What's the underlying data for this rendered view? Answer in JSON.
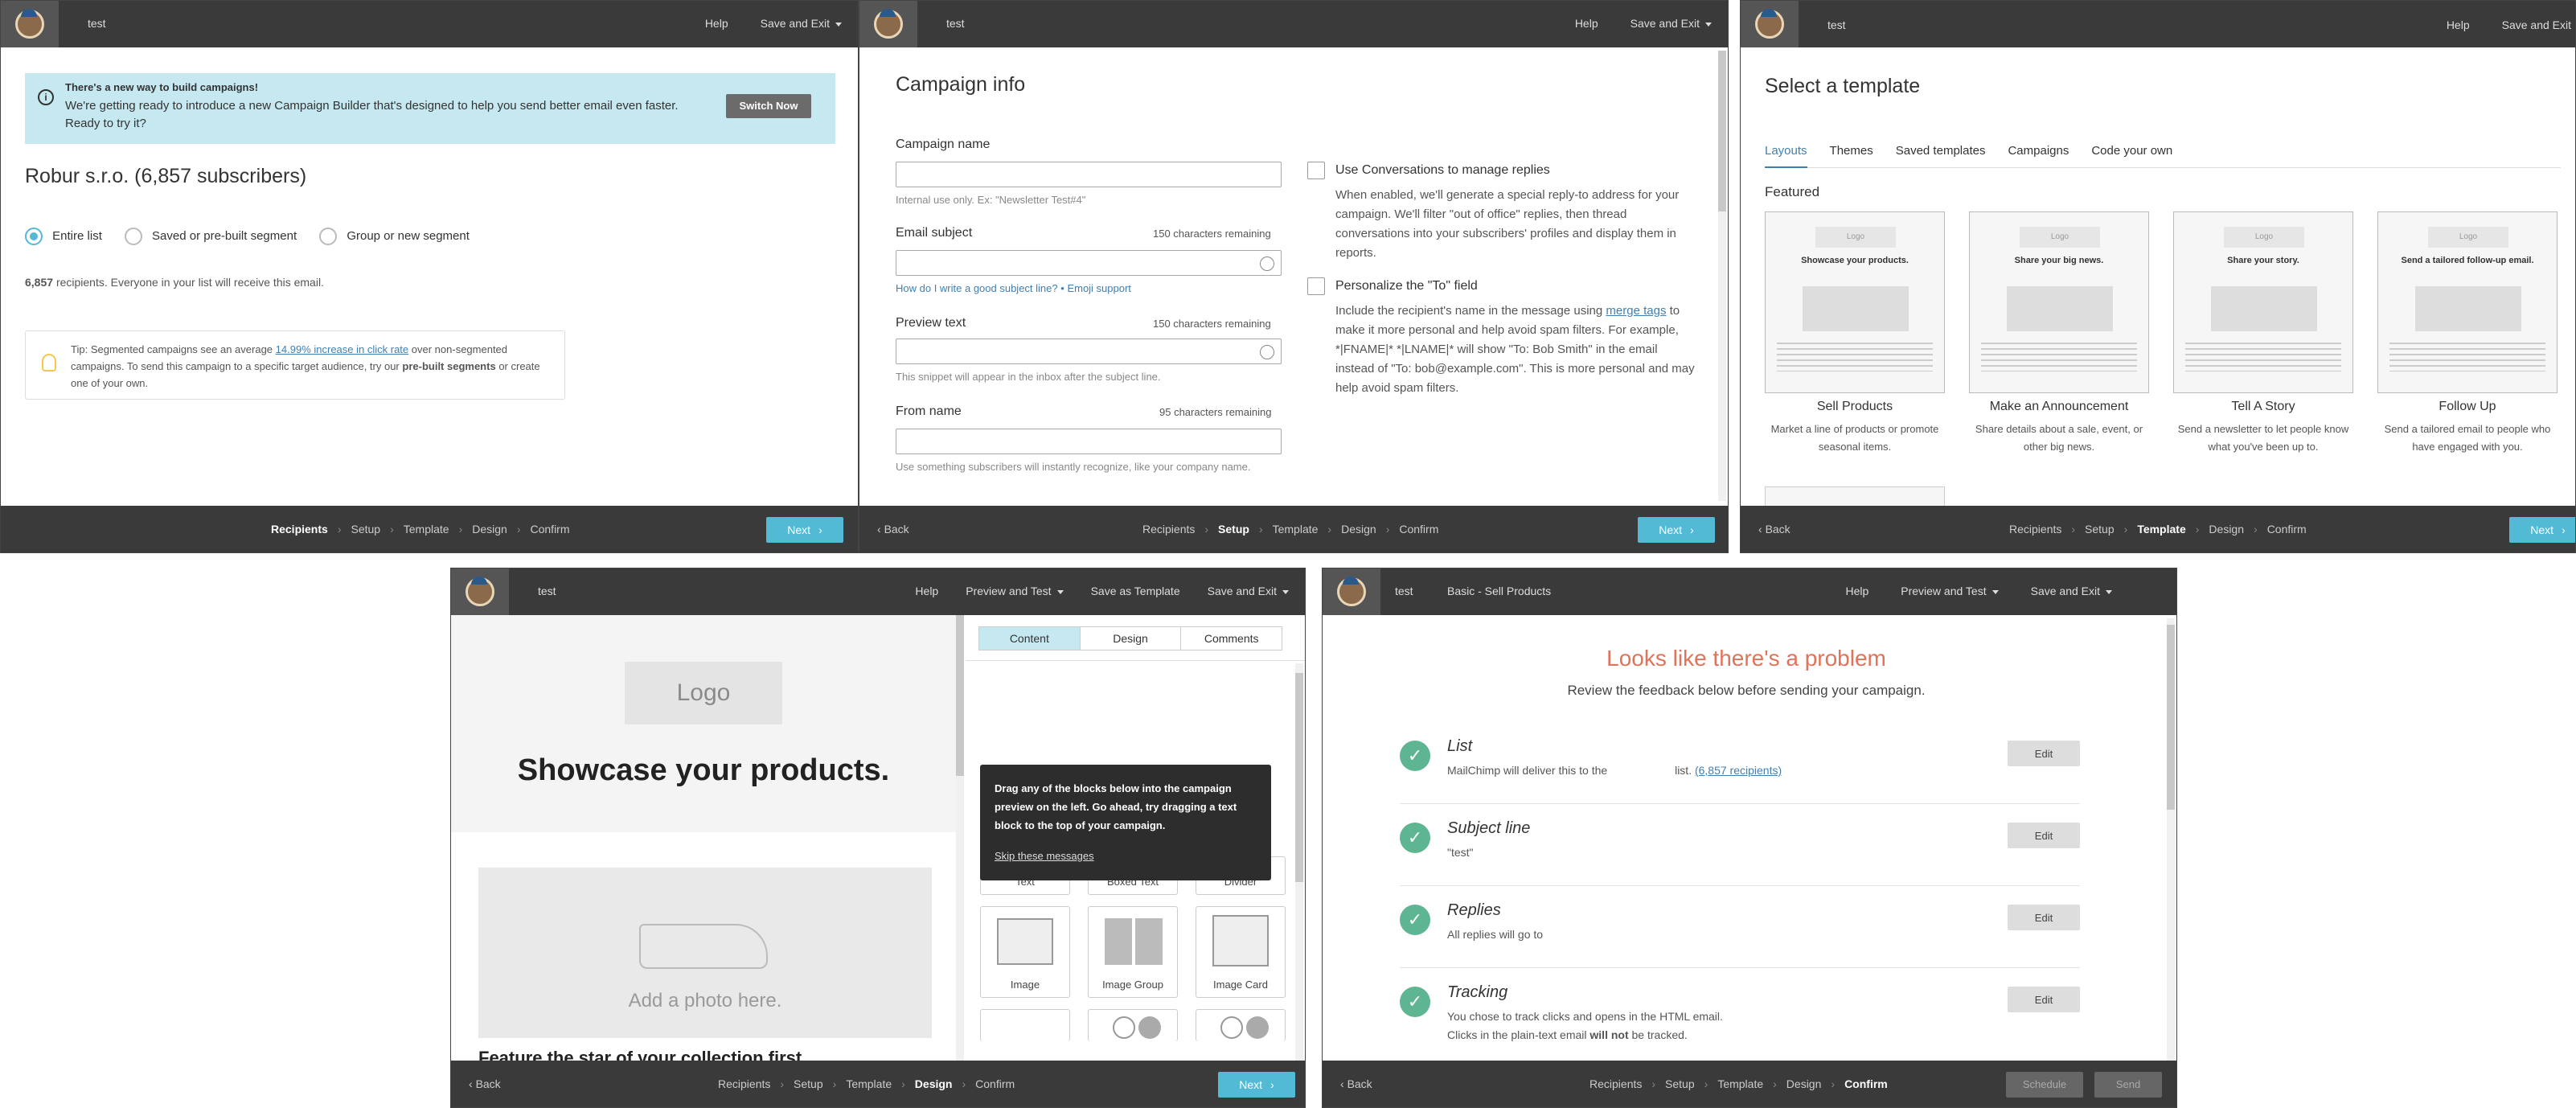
{
  "p1": {
    "topbar": {
      "title": "test",
      "help": "Help",
      "save_exit": "Save and Exit"
    },
    "banner": {
      "heading": "There's a new way to build campaigns!",
      "body": "We're getting ready to introduce a new Campaign Builder that's designed to help you send better email even faster. Ready to try it?",
      "button": "Switch Now"
    },
    "list_title": "Robur s.r.o. (6,857 subscribers)",
    "radios": [
      "Entire list",
      "Saved or pre-built segment",
      "Group or new segment"
    ],
    "recipients_count": "6,857",
    "recipients_text": "recipients. Everyone in your list will receive this email.",
    "tip": {
      "label": "Tip:",
      "pre": "Segmented campaigns see an average",
      "link": "14.99% increase in click rate",
      "mid": "over non-segmented campaigns. To send this campaign to a specific target audience, try our",
      "bold": "pre-built segments",
      "post": "or create one of your own."
    },
    "crumbs": [
      "Recipients",
      "Setup",
      "Template",
      "Design",
      "Confirm"
    ],
    "next": "Next"
  },
  "p2": {
    "topbar": {
      "title": "test",
      "help": "Help",
      "save_exit": "Save and Exit"
    },
    "heading": "Campaign info",
    "campaign_name": {
      "label": "Campaign name",
      "hint": "Internal use only. Ex: \"Newsletter Test#4\""
    },
    "subject": {
      "label": "Email subject",
      "remaining": "150 characters remaining",
      "help_link": "How do I write a good subject line?",
      "dot": "•",
      "emoji_link": "Emoji support"
    },
    "preview": {
      "label": "Preview text",
      "remaining": "150 characters remaining",
      "hint": "This snippet will appear in the inbox after the subject line."
    },
    "from": {
      "label": "From name",
      "remaining": "95 characters remaining",
      "hint": "Use something subscribers will instantly recognize, like your company name."
    },
    "conversations": {
      "label": "Use Conversations to manage replies",
      "body": "When enabled, we'll generate a special reply-to address for your campaign. We'll filter \"out of office\" replies, then thread conversations into your subscribers' profiles and display them in reports."
    },
    "personalize": {
      "label": "Personalize the \"To\" field",
      "body_pre": "Include the recipient's name in the message using",
      "link": "merge tags",
      "body_post": "to make it more personal and help avoid spam filters. For example, *|FNAME|* *|LNAME|* will show \"To: Bob Smith\" in the email instead of \"To: bob@example.com\". This is more personal and may help avoid spam filters."
    },
    "back": "Back",
    "crumbs": [
      "Recipients",
      "Setup",
      "Template",
      "Design",
      "Confirm"
    ],
    "next": "Next"
  },
  "p3": {
    "topbar": {
      "title": "test",
      "help": "Help",
      "save_exit": "Save and Exit"
    },
    "heading": "Select a template",
    "tabs": [
      "Layouts",
      "Themes",
      "Saved templates",
      "Campaigns",
      "Code your own"
    ],
    "featured": "Featured",
    "templates": [
      {
        "thumb_logo": "Logo",
        "thumb_title": "Showcase your products.",
        "name": "Sell Products",
        "desc": "Market a line of products or promote seasonal items."
      },
      {
        "thumb_logo": "Logo",
        "thumb_title": "Share your big news.",
        "name": "Make an Announcement",
        "desc": "Share details about a sale, event, or other big news."
      },
      {
        "thumb_logo": "Logo",
        "thumb_title": "Share your story.",
        "name": "Tell A Story",
        "desc": "Send a newsletter to let people know what you've been up to."
      },
      {
        "thumb_logo": "Logo",
        "thumb_title": "Send a tailored follow-up email.",
        "name": "Follow Up",
        "desc": "Send a tailored email to people who have engaged with you."
      }
    ],
    "back": "Back",
    "crumbs": [
      "Recipients",
      "Setup",
      "Template",
      "Design",
      "Confirm"
    ],
    "next": "Next"
  },
  "p4": {
    "topbar": {
      "title": "test",
      "help": "Help",
      "preview_test": "Preview and Test",
      "save_template": "Save as Template",
      "save_exit": "Save and Exit"
    },
    "preview": {
      "logo": "Logo",
      "headline": "Showcase your products.",
      "photo": "Add a photo here.",
      "feature": "Feature the star of your collection first."
    },
    "tabs": [
      "Content",
      "Design",
      "Comments"
    ],
    "tooltip": {
      "text": "Drag any of the blocks below into the campaign preview on the left. Go ahead, try dragging a text block to the top of your campaign.",
      "skip": "Skip these messages"
    },
    "blocks": [
      "Text",
      "Boxed Text",
      "Divider",
      "Image",
      "Image Group",
      "Image Card"
    ],
    "back": "Back",
    "crumbs": [
      "Recipients",
      "Setup",
      "Template",
      "Design",
      "Confirm"
    ],
    "next": "Next"
  },
  "p5": {
    "topbar": {
      "title": "test",
      "subtitle": "Basic - Sell Products",
      "help": "Help",
      "preview_test": "Preview and Test",
      "save_exit": "Save and Exit"
    },
    "heading": "Looks like there's a problem",
    "subheading": "Review the feedback below before sending your campaign.",
    "items": [
      {
        "title": "List",
        "line1_pre": "MailChimp will deliver this to the",
        "line1_mid": "list.",
        "link": "(6,857 recipients)",
        "edit": "Edit"
      },
      {
        "title": "Subject line",
        "line1": "\"test\"",
        "edit": "Edit"
      },
      {
        "title": "Replies",
        "line1": "All replies will go to",
        "edit": "Edit"
      },
      {
        "title": "Tracking",
        "line1": "You chose to track clicks and opens in the HTML email.",
        "line2_pre": "Clicks in the plain-text email",
        "line2_bold": "will not",
        "line2_post": "be tracked.",
        "edit": "Edit"
      }
    ],
    "back": "Back",
    "crumbs": [
      "Recipients",
      "Setup",
      "Template",
      "Design",
      "Confirm"
    ],
    "schedule": "Schedule",
    "send": "Send"
  }
}
